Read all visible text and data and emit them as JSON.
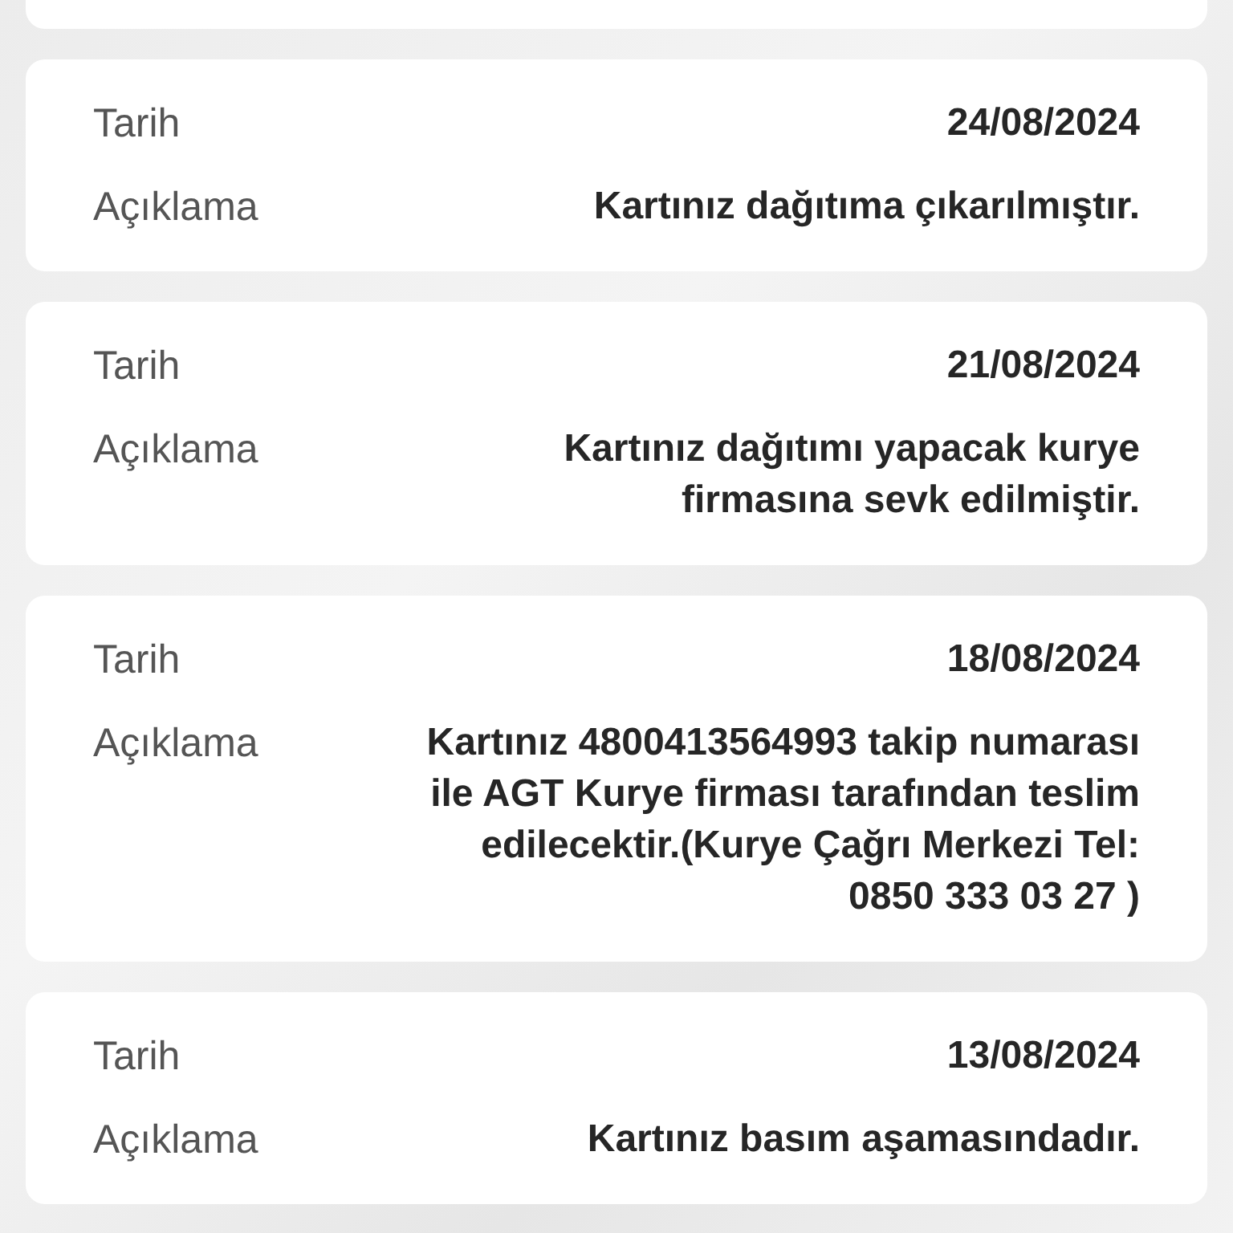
{
  "cards": [
    {
      "date_label": "Tarih",
      "date": "24/08/2024",
      "description_label": "Açıklama",
      "description": "Kartınız dağıtıma çıkarılmıştır."
    },
    {
      "date_label": "Tarih",
      "date": "21/08/2024",
      "description_label": "Açıklama",
      "description": "Kartınız dağıtımı yapacak kurye firmasına sevk edilmiştir."
    },
    {
      "date_label": "Tarih",
      "date": "18/08/2024",
      "description_label": "Açıklama",
      "description": "Kartınız 4800413564993 takip numarası ile AGT Kurye firması tarafından teslim edilecektir.(Kurye Çağrı Merkezi Tel: 0850 333 03 27 )"
    },
    {
      "date_label": "Tarih",
      "date": "13/08/2024",
      "description_label": "Açıklama",
      "description": "Kartınız basım aşamasındadır."
    }
  ]
}
